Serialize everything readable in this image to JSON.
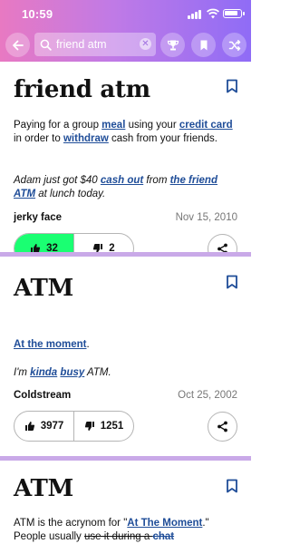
{
  "status_bar": {
    "time": "10:59"
  },
  "search": {
    "value": "friend atm"
  },
  "colors": {
    "accent": "#1f4d98",
    "upvote_active": "#1aff72",
    "separator": "#c9a9e8"
  },
  "icons": [
    "back-arrow-icon",
    "search-icon",
    "clear-icon",
    "trophy-icon",
    "bookmark-icon",
    "shuffle-icon",
    "thumbs-up-icon",
    "thumbs-down-icon",
    "share-icon"
  ],
  "definitions": [
    {
      "word": "friend atm",
      "meaning": [
        {
          "t": "Paying for a group "
        },
        {
          "t": "meal",
          "link": true
        },
        {
          "t": " using your "
        },
        {
          "t": "credit card",
          "link": true
        },
        {
          "t": " in order to "
        },
        {
          "t": "withdraw",
          "link": true
        },
        {
          "t": " cash from your friends."
        }
      ],
      "example": [
        {
          "t": "Adam just got $40 "
        },
        {
          "t": "cash out",
          "link": true
        },
        {
          "t": " from "
        },
        {
          "t": "the friend ATM",
          "link": true
        },
        {
          "t": " at lunch today."
        }
      ],
      "author": "jerky face",
      "date": "Nov 15, 2010",
      "upvotes": "32",
      "downvotes": "2",
      "upvoted": true
    },
    {
      "word": "ATM",
      "meaning": [
        {
          "t": "At the moment",
          "link": true
        },
        {
          "t": "."
        }
      ],
      "example": [
        {
          "t": "I'm "
        },
        {
          "t": "kinda",
          "link": true
        },
        {
          "t": " "
        },
        {
          "t": "busy",
          "link": true
        },
        {
          "t": " ATM."
        }
      ],
      "author": "Coldstream",
      "date": "Oct 25, 2002",
      "upvotes": "3977",
      "downvotes": "1251",
      "upvoted": false
    },
    {
      "word": "ATM",
      "meaning": [
        {
          "t": "ATM is the acrynom for \""
        },
        {
          "t": "At The Moment",
          "link": true
        },
        {
          "t": ".\" People usually "
        },
        {
          "t": "use it during a ",
          "strike": true
        },
        {
          "t": "chat",
          "link": true,
          "strike": true
        }
      ]
    }
  ]
}
